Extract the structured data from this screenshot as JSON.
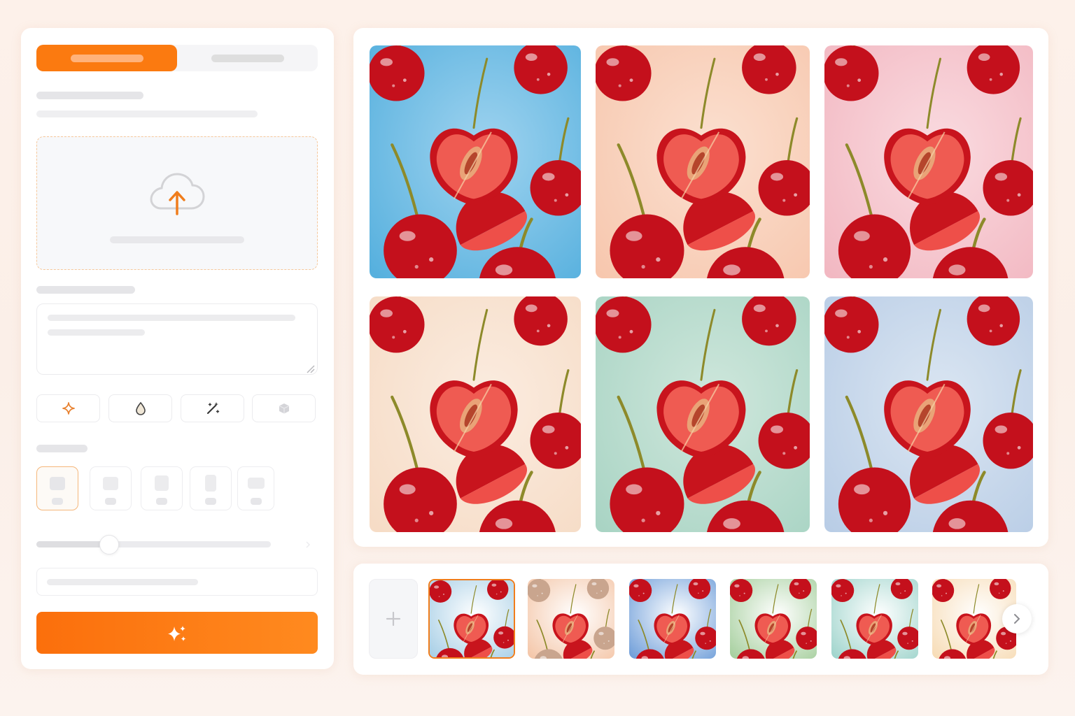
{
  "tabs": [
    {
      "label": "",
      "active": true
    },
    {
      "label": "",
      "active": false
    }
  ],
  "upload": {
    "icon": "cloud-upload-icon",
    "hint": ""
  },
  "prompt": {
    "value": "",
    "placeholder": ""
  },
  "tools": [
    {
      "icon": "sparkle-icon",
      "enabled": true
    },
    {
      "icon": "droplet-icon",
      "enabled": true
    },
    {
      "icon": "magic-wand-icon",
      "enabled": true
    },
    {
      "icon": "cube-icon",
      "enabled": false
    }
  ],
  "ratios": [
    {
      "shape": "square",
      "selected": true
    },
    {
      "shape": "landscape",
      "selected": false
    },
    {
      "shape": "portrait",
      "selected": false
    },
    {
      "shape": "tall",
      "selected": false
    },
    {
      "shape": "wide",
      "selected": false
    }
  ],
  "slider": {
    "value_fraction": 0.31
  },
  "seed_input": {
    "value": "",
    "placeholder": ""
  },
  "generate": {
    "label": "",
    "icon": "sparkles-icon",
    "color_start": "#fb6f0c",
    "color_end": "#ff8a1f"
  },
  "results": [
    {
      "bg": "#56b0de",
      "bg2": "#9fd3ef"
    },
    {
      "bg": "#f7c7ae",
      "bg2": "#fbe0d0"
    },
    {
      "bg": "#f2b8c2",
      "bg2": "#fadbe0"
    },
    {
      "bg": "#f6dcc6",
      "bg2": "#fbece0"
    },
    {
      "bg": "#a9d4c4",
      "bg2": "#cfe7dc"
    },
    {
      "bg": "#b9cde6",
      "bg2": "#dbe6f2"
    }
  ],
  "thumbnails": [
    {
      "bg": "#a8cfe6",
      "selected": true
    },
    {
      "bg": "#f4c6a8",
      "selected": false,
      "tint": "#c9a58e"
    },
    {
      "bg": "#6f9ed9",
      "selected": false
    },
    {
      "bg": "#a6cf9e",
      "selected": false
    },
    {
      "bg": "#9fd4cc",
      "selected": false
    },
    {
      "bg": "#f7dcb6",
      "selected": false
    }
  ],
  "accent_color": "#fb7a10"
}
